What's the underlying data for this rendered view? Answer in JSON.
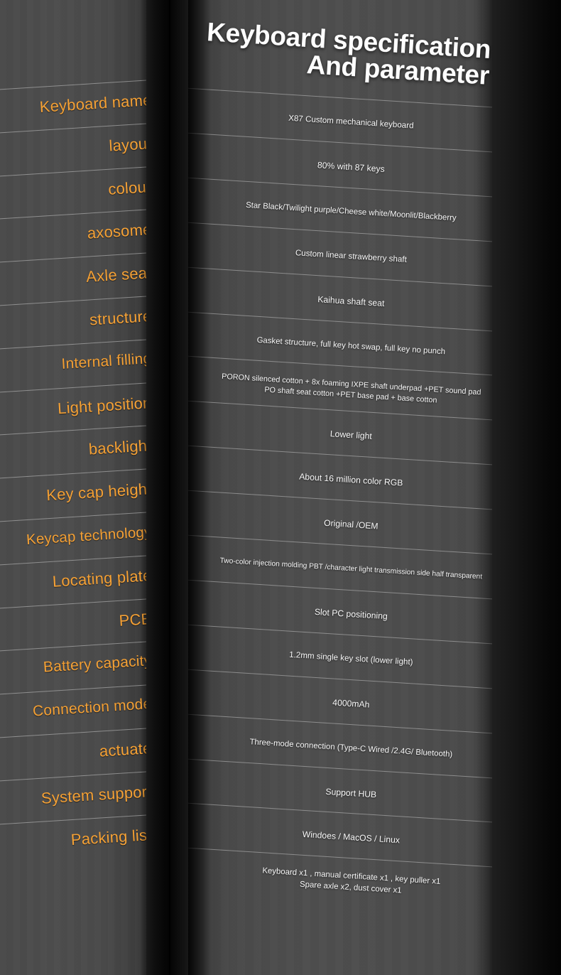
{
  "title": {
    "line1": "Keyboard specification",
    "line2": "And parameter"
  },
  "colors": {
    "label_orange": "#F6A134",
    "value_white": "#FAFAFA",
    "panel_grey": "#4A4A4A",
    "background_dark": "#0D0D0D"
  },
  "spec_rows": [
    {
      "label": "Keyboard name",
      "value": "X87 Custom mechanical keyboard"
    },
    {
      "label": "layout",
      "value": "80% with 87 keys"
    },
    {
      "label": "colour",
      "value": "Star Black/Twilight purple/Cheese white/Moonlit/Blackberry"
    },
    {
      "label": "axosome",
      "value": "Custom linear strawberry shaft"
    },
    {
      "label": "Axle seat",
      "value": "Kaihua shaft seat"
    },
    {
      "label": "structure",
      "value": "Gasket structure, full key hot swap, full key no punch"
    },
    {
      "label": "Internal filling",
      "value": "PORON silenced cotton + 8x foaming IXPE shaft underpad +PET sound pad\nPO shaft seat cotton +PET base pad + base cotton"
    },
    {
      "label": "Light position",
      "value": "Lower light"
    },
    {
      "label": "backlight",
      "value": "About 16 million color RGB"
    },
    {
      "label": "Key cap height",
      "value": "Original /OEM"
    },
    {
      "label": "Keycap technology",
      "value": "Two-color injection molding PBT /character light transmission side half transparent"
    },
    {
      "label": "Locating plate",
      "value": "Slot PC positioning"
    },
    {
      "label": "PCB",
      "value": "1.2mm single key slot (lower light)"
    },
    {
      "label": "Battery capacity",
      "value": "4000mAh"
    },
    {
      "label": "Connection mode",
      "value": "Three-mode connection (Type-C Wired /2.4G/ Bluetooth)"
    },
    {
      "label": "actuate",
      "value": "Support HUB"
    },
    {
      "label": "System support",
      "value": "Windoes / MacOS / Linux"
    },
    {
      "label": "Packing list",
      "value": "Keyboard x1 , manual certificate x1 , key puller x1\nSpare axle x2, dust cover x1"
    }
  ]
}
